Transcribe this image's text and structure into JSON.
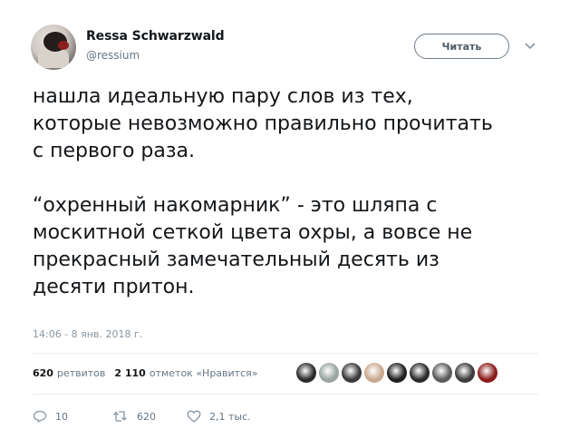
{
  "author": {
    "name": "Ressa Schwarzwald",
    "handle": "@ressium"
  },
  "follow_button_label": "Читать",
  "tweet": {
    "paragraph1": [
      "нашла идеальную пару слов из тех,",
      "которые невозможно правильно прочитать",
      "с первого раза."
    ],
    "paragraph2": [
      "“охренный накомарник” - это шляпа с",
      "москитной сеткой цвета охры, а вовсе не",
      "прекрасный замечательный десять из",
      "десяти притон."
    ]
  },
  "timestamp": "14:06 - 8 янв. 2018 г.",
  "stats": {
    "retweets_count": "620",
    "retweets_label": "ретвитов",
    "likes_count": "2 110",
    "likes_label": "отметок «Нравится»"
  },
  "liker_avatar_colors": [
    "#2b2b2b",
    "#9aa5a0",
    "#3a3a3a",
    "#c9a990",
    "#1e1e1e",
    "#2a2a2a",
    "#5c5c5c",
    "#3b3b3b",
    "#8b1c1c"
  ],
  "actions": {
    "reply_count": "10",
    "retweet_count": "620",
    "like_count": "2,1 тыс."
  },
  "icons": {
    "reply": "reply-icon",
    "retweet": "retweet-icon",
    "like": "heart-icon",
    "more": "chevron-down-icon"
  }
}
